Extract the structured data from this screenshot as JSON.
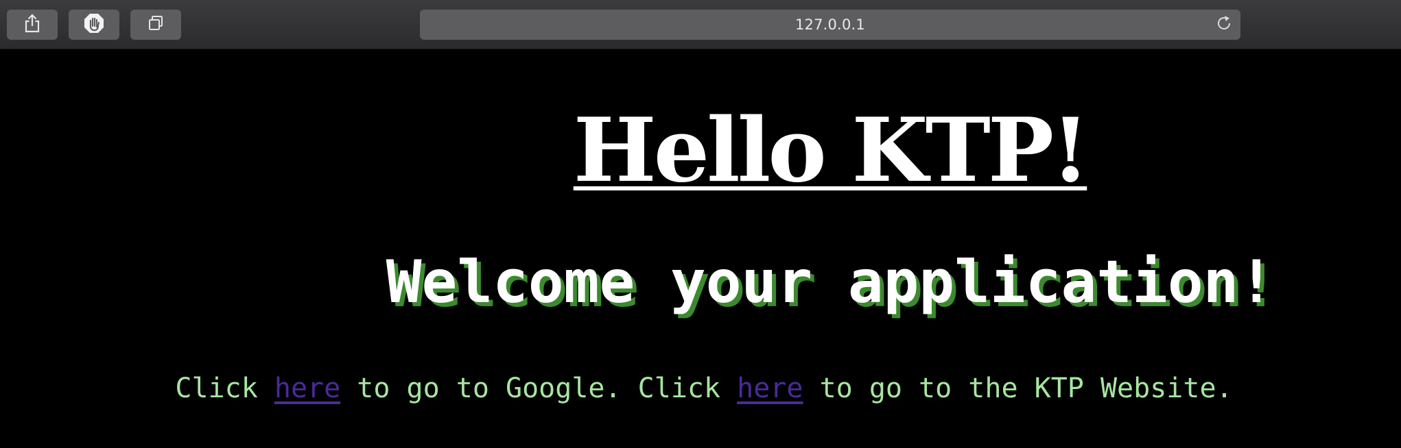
{
  "browser": {
    "url": "127.0.0.1",
    "toolbar_buttons": [
      {
        "icon": "share-icon"
      },
      {
        "icon": "content-blocker-icon"
      },
      {
        "icon": "tabs-overview-icon"
      }
    ],
    "reload_icon": "reload-icon"
  },
  "page": {
    "title": "Hello KTP!",
    "welcome": "Welcome your application!",
    "links_line": {
      "part1": "Click ",
      "link1": "here",
      "part2": " to go to Google. Click ",
      "link2": "here",
      "part3": " to go to the KTP Website."
    }
  },
  "colors": {
    "background": "#000000",
    "title": "#ffffff",
    "welcome_text": "#ffffff",
    "welcome_shadow": "#3c8a2e",
    "body_text": "#a6e6a0",
    "link": "#4b2a98",
    "toolbar": "#333335"
  }
}
